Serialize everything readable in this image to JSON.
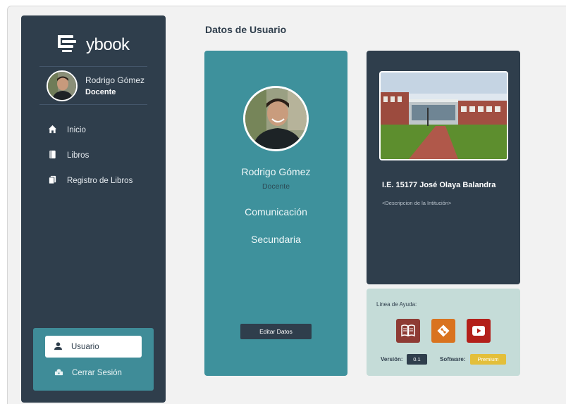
{
  "brand": {
    "name": "ybook"
  },
  "sidebar": {
    "user_name": "Rodrigo Gómez",
    "user_role": "Docente",
    "nav": [
      {
        "label": "Inicio",
        "icon": "home-icon"
      },
      {
        "label": "Libros",
        "icon": "book-icon"
      },
      {
        "label": "Registro de Libros",
        "icon": "books-icon"
      }
    ],
    "usuario_label": "Usuario",
    "logout_label": "Cerrar Sesión"
  },
  "page": {
    "title": "Datos de Usuario"
  },
  "profile_card": {
    "name": "Rodrigo Gómez",
    "role": "Docente",
    "subject": "Comunicación",
    "level": "Secundaria",
    "edit_label": "Editar Datos"
  },
  "institution": {
    "name": "I.E. 15177 José Olaya Balandra",
    "description": "<Descripcion de la Intitución>"
  },
  "help": {
    "title": "Linea de Ayuda:",
    "icons": [
      "open-book-icon",
      "git-icon",
      "youtube-icon"
    ],
    "version_label": "Versión:",
    "version_value": "0.1",
    "software_label": "Software:",
    "software_value": "Premium"
  },
  "colors": {
    "sidebar": "#2f3e4c",
    "teal": "#3e919c",
    "help_bg": "#c5dcd8",
    "book_red": "#8e3b34",
    "git_orange": "#d9731f",
    "youtube_red": "#b3201a",
    "premium": "#e3bf3a"
  }
}
